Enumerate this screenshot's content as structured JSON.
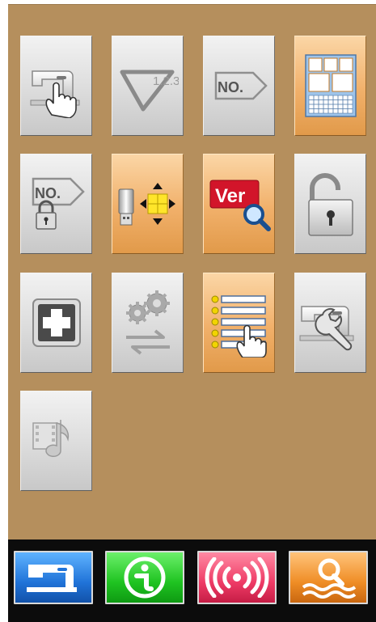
{
  "grid": {
    "tiles": [
      {
        "id": "sewing-machine-touch",
        "icon": "sewing-machine-hand-icon",
        "active": false
      },
      {
        "id": "triangle-123",
        "icon": "triangle-numbers-icon",
        "label": "1.2.3..",
        "active": false
      },
      {
        "id": "no-tag",
        "icon": "number-tag-icon",
        "label": "NO.",
        "active": false
      },
      {
        "id": "layout",
        "icon": "layout-grid-icon",
        "active": true
      },
      {
        "id": "no-lock",
        "icon": "number-lock-icon",
        "label": "NO.",
        "active": false
      },
      {
        "id": "usb-transfer",
        "icon": "usb-transfer-icon",
        "active": true
      },
      {
        "id": "version",
        "icon": "version-search-icon",
        "label": "Ver",
        "active": true
      },
      {
        "id": "unlock",
        "icon": "open-padlock-icon",
        "active": false
      },
      {
        "id": "add",
        "icon": "plus-icon",
        "active": false
      },
      {
        "id": "settings-swap",
        "icon": "gears-swap-icon",
        "active": false
      },
      {
        "id": "list-touch",
        "icon": "list-hand-icon",
        "active": true
      },
      {
        "id": "maintenance",
        "icon": "sewing-machine-wrench-icon",
        "active": false
      },
      {
        "id": "media",
        "icon": "film-music-icon",
        "active": false
      }
    ]
  },
  "bottom_bar": {
    "buttons": [
      {
        "id": "sewing",
        "icon": "sewing-machine-icon",
        "color": "#2073d8"
      },
      {
        "id": "info",
        "icon": "info-icon",
        "color": "#1fc321"
      },
      {
        "id": "wireless",
        "icon": "wireless-signal-icon",
        "color": "#ee3b66"
      },
      {
        "id": "search-waves",
        "icon": "search-waves-icon",
        "color": "#ef8d25"
      }
    ]
  },
  "colors": {
    "panel_bg": "#b58f5d",
    "tile_active": "#f1b06a",
    "tile_inactive": "#dcdcdc"
  }
}
